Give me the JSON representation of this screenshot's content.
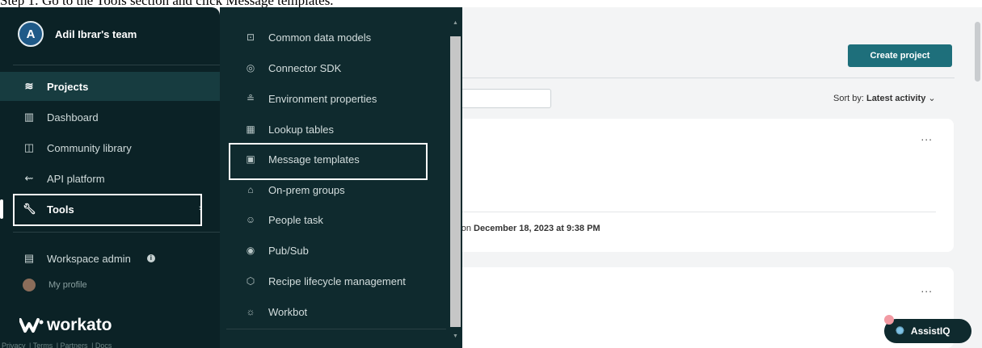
{
  "caption": "Step 1: Go to the Tools section and click Message templates.",
  "sidebar": {
    "team_initial": "A",
    "team_name": "Adil Ibrar's team",
    "items": [
      {
        "label": "Projects",
        "icon": "layers-icon"
      },
      {
        "label": "Dashboard",
        "icon": "bar-chart-icon"
      },
      {
        "label": "Community library",
        "icon": "book-icon"
      },
      {
        "label": "API platform",
        "icon": "api-icon"
      },
      {
        "label": "Tools",
        "icon": "wrench-icon"
      },
      {
        "label": "Workspace admin",
        "icon": "building-icon"
      },
      {
        "label": "My profile",
        "icon": "avatar"
      }
    ],
    "info_badge": "i",
    "logo_text": "workato",
    "footer": [
      "Privacy",
      "Terms",
      "Partners",
      "Docs"
    ]
  },
  "tools_menu": {
    "items": [
      {
        "label": "Common data models",
        "icon": "data-model-icon"
      },
      {
        "label": "Connector SDK",
        "icon": "sdk-icon"
      },
      {
        "label": "Environment properties",
        "icon": "environment-icon"
      },
      {
        "label": "Lookup tables",
        "icon": "table-icon"
      },
      {
        "label": "Message templates",
        "icon": "template-icon"
      },
      {
        "label": "On-prem groups",
        "icon": "on-prem-icon"
      },
      {
        "label": "People task",
        "icon": "person-task-icon"
      },
      {
        "label": "Pub/Sub",
        "icon": "broadcast-icon"
      },
      {
        "label": "Recipe lifecycle management",
        "icon": "cube-icon"
      },
      {
        "label": "Workbot",
        "icon": "bot-icon"
      }
    ]
  },
  "main": {
    "create_button": "Create project",
    "sort_prefix": "Sort by:",
    "sort_value": "Latest activity",
    "card_meta_prefix": "r on",
    "card_meta_date": "December 18, 2023 at 9:38 PM",
    "more_label": "..."
  },
  "assist": {
    "label": "AssistIQ"
  },
  "colors": {
    "sidebar_bg": "#0b2226",
    "flyout_bg": "#0f2a2e",
    "accent_button": "#1e6f7b",
    "highlight_box": "#ffffff"
  }
}
